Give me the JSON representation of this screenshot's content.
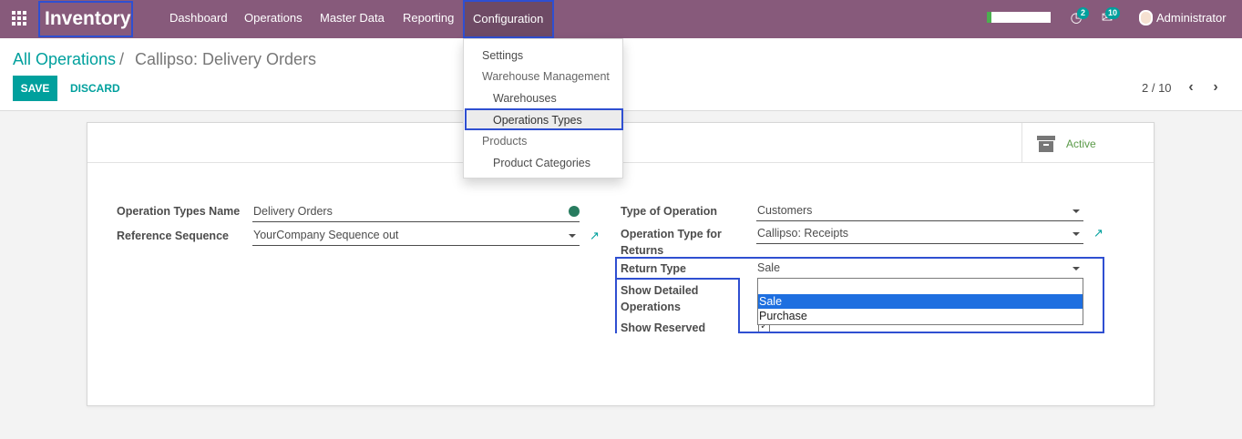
{
  "navbar": {
    "app_name": "Inventory",
    "menu": [
      "Dashboard",
      "Operations",
      "Master Data",
      "Reporting",
      "Configuration"
    ],
    "activity_count": "2",
    "message_count": "10",
    "user": "Administrator"
  },
  "breadcrumb": {
    "parent": "All Operations",
    "separator": "/",
    "current": "Callipso: Delivery Orders"
  },
  "buttons": {
    "save": "SAVE",
    "discard": "DISCARD"
  },
  "pager": {
    "text": "2 / 10"
  },
  "config_menu": {
    "settings": "Settings",
    "warehouse_management": "Warehouse Management",
    "warehouses": "Warehouses",
    "operations_types": "Operations Types",
    "products": "Products",
    "product_categories": "Product Categories"
  },
  "form": {
    "active_label": "Active",
    "operation_types_name_label": "Operation Types Name",
    "operation_types_name": "Delivery Orders",
    "reference_sequence_label": "Reference Sequence",
    "reference_sequence": "YourCompany Sequence out",
    "type_of_operation_label": "Type of Operation",
    "type_of_operation": "Customers",
    "return_type_op_label_1": "Operation Type for",
    "return_type_op_label_2": "Returns",
    "return_type_op": "Callipso: Receipts",
    "return_type_label": "Return Type",
    "return_type": "Sale",
    "return_type_options": [
      "",
      "Sale",
      "Purchase"
    ],
    "show_detailed_label_1": "Show Detailed",
    "show_detailed_label_2": "Operations",
    "show_reserved_label": "Show Reserved"
  },
  "colors": {
    "brand": "#875a7b",
    "accent": "#00a09d",
    "highlight": "#2f4fd1"
  }
}
